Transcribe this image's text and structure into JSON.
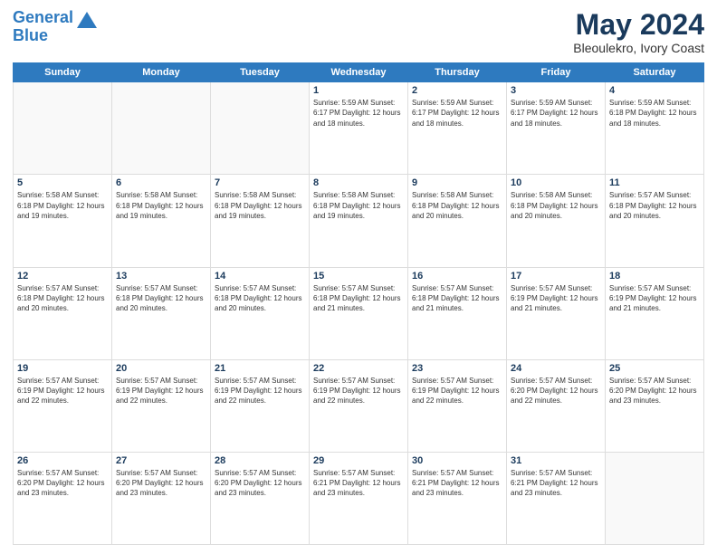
{
  "header": {
    "logo_line1": "General",
    "logo_line2": "Blue",
    "main_title": "May 2024",
    "subtitle": "Bleoulekro, Ivory Coast"
  },
  "calendar": {
    "days_of_week": [
      "Sunday",
      "Monday",
      "Tuesday",
      "Wednesday",
      "Thursday",
      "Friday",
      "Saturday"
    ],
    "weeks": [
      [
        {
          "day": "",
          "info": ""
        },
        {
          "day": "",
          "info": ""
        },
        {
          "day": "",
          "info": ""
        },
        {
          "day": "1",
          "info": "Sunrise: 5:59 AM\nSunset: 6:17 PM\nDaylight: 12 hours\nand 18 minutes."
        },
        {
          "day": "2",
          "info": "Sunrise: 5:59 AM\nSunset: 6:17 PM\nDaylight: 12 hours\nand 18 minutes."
        },
        {
          "day": "3",
          "info": "Sunrise: 5:59 AM\nSunset: 6:17 PM\nDaylight: 12 hours\nand 18 minutes."
        },
        {
          "day": "4",
          "info": "Sunrise: 5:59 AM\nSunset: 6:18 PM\nDaylight: 12 hours\nand 18 minutes."
        }
      ],
      [
        {
          "day": "5",
          "info": "Sunrise: 5:58 AM\nSunset: 6:18 PM\nDaylight: 12 hours\nand 19 minutes."
        },
        {
          "day": "6",
          "info": "Sunrise: 5:58 AM\nSunset: 6:18 PM\nDaylight: 12 hours\nand 19 minutes."
        },
        {
          "day": "7",
          "info": "Sunrise: 5:58 AM\nSunset: 6:18 PM\nDaylight: 12 hours\nand 19 minutes."
        },
        {
          "day": "8",
          "info": "Sunrise: 5:58 AM\nSunset: 6:18 PM\nDaylight: 12 hours\nand 19 minutes."
        },
        {
          "day": "9",
          "info": "Sunrise: 5:58 AM\nSunset: 6:18 PM\nDaylight: 12 hours\nand 20 minutes."
        },
        {
          "day": "10",
          "info": "Sunrise: 5:58 AM\nSunset: 6:18 PM\nDaylight: 12 hours\nand 20 minutes."
        },
        {
          "day": "11",
          "info": "Sunrise: 5:57 AM\nSunset: 6:18 PM\nDaylight: 12 hours\nand 20 minutes."
        }
      ],
      [
        {
          "day": "12",
          "info": "Sunrise: 5:57 AM\nSunset: 6:18 PM\nDaylight: 12 hours\nand 20 minutes."
        },
        {
          "day": "13",
          "info": "Sunrise: 5:57 AM\nSunset: 6:18 PM\nDaylight: 12 hours\nand 20 minutes."
        },
        {
          "day": "14",
          "info": "Sunrise: 5:57 AM\nSunset: 6:18 PM\nDaylight: 12 hours\nand 20 minutes."
        },
        {
          "day": "15",
          "info": "Sunrise: 5:57 AM\nSunset: 6:18 PM\nDaylight: 12 hours\nand 21 minutes."
        },
        {
          "day": "16",
          "info": "Sunrise: 5:57 AM\nSunset: 6:18 PM\nDaylight: 12 hours\nand 21 minutes."
        },
        {
          "day": "17",
          "info": "Sunrise: 5:57 AM\nSunset: 6:19 PM\nDaylight: 12 hours\nand 21 minutes."
        },
        {
          "day": "18",
          "info": "Sunrise: 5:57 AM\nSunset: 6:19 PM\nDaylight: 12 hours\nand 21 minutes."
        }
      ],
      [
        {
          "day": "19",
          "info": "Sunrise: 5:57 AM\nSunset: 6:19 PM\nDaylight: 12 hours\nand 22 minutes."
        },
        {
          "day": "20",
          "info": "Sunrise: 5:57 AM\nSunset: 6:19 PM\nDaylight: 12 hours\nand 22 minutes."
        },
        {
          "day": "21",
          "info": "Sunrise: 5:57 AM\nSunset: 6:19 PM\nDaylight: 12 hours\nand 22 minutes."
        },
        {
          "day": "22",
          "info": "Sunrise: 5:57 AM\nSunset: 6:19 PM\nDaylight: 12 hours\nand 22 minutes."
        },
        {
          "day": "23",
          "info": "Sunrise: 5:57 AM\nSunset: 6:19 PM\nDaylight: 12 hours\nand 22 minutes."
        },
        {
          "day": "24",
          "info": "Sunrise: 5:57 AM\nSunset: 6:20 PM\nDaylight: 12 hours\nand 22 minutes."
        },
        {
          "day": "25",
          "info": "Sunrise: 5:57 AM\nSunset: 6:20 PM\nDaylight: 12 hours\nand 23 minutes."
        }
      ],
      [
        {
          "day": "26",
          "info": "Sunrise: 5:57 AM\nSunset: 6:20 PM\nDaylight: 12 hours\nand 23 minutes."
        },
        {
          "day": "27",
          "info": "Sunrise: 5:57 AM\nSunset: 6:20 PM\nDaylight: 12 hours\nand 23 minutes."
        },
        {
          "day": "28",
          "info": "Sunrise: 5:57 AM\nSunset: 6:20 PM\nDaylight: 12 hours\nand 23 minutes."
        },
        {
          "day": "29",
          "info": "Sunrise: 5:57 AM\nSunset: 6:21 PM\nDaylight: 12 hours\nand 23 minutes."
        },
        {
          "day": "30",
          "info": "Sunrise: 5:57 AM\nSunset: 6:21 PM\nDaylight: 12 hours\nand 23 minutes."
        },
        {
          "day": "31",
          "info": "Sunrise: 5:57 AM\nSunset: 6:21 PM\nDaylight: 12 hours\nand 23 minutes."
        },
        {
          "day": "",
          "info": ""
        }
      ]
    ]
  }
}
